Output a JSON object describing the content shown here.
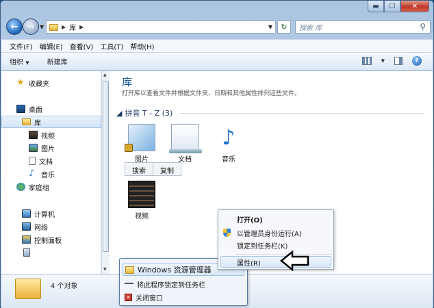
{
  "address": {
    "crumb": "库",
    "search_placeholder": "搜索 库"
  },
  "menu": [
    "文件(F)",
    "编辑(E)",
    "查看(V)",
    "工具(T)",
    "帮助(H)"
  ],
  "toolbar": {
    "organize": "组织",
    "new_library": "新建库"
  },
  "nav": {
    "favorites": "收藏夹",
    "desktop": "桌面",
    "libraries": "库",
    "videos": "视频",
    "pictures": "图片",
    "documents": "文档",
    "music": "音乐",
    "homegroup": "家庭组",
    "computer": "计算机",
    "network": "网络",
    "control_panel": "控制面板"
  },
  "main": {
    "title": "库",
    "description": "打开库以查看文件并根据文件夹、日期和其他属性排列这些文件。",
    "group": "拼音 T - Z (3)",
    "items": {
      "pictures": "图片",
      "documents": "文档",
      "music": "音乐",
      "videos": "视频"
    },
    "tabs": {
      "search": "搜索",
      "copy": "复制"
    }
  },
  "status": {
    "count": "4 个对象"
  },
  "jumplist": {
    "app": "Windows 资源管理器",
    "pin": "将此程序锁定到任务栏",
    "close": "关闭窗口"
  },
  "context_menu": {
    "open": "打开(O)",
    "run_admin": "以管理员身份运行(A)",
    "pin_taskbar": "锁定到任务栏(K)",
    "properties": "属性(R)"
  }
}
